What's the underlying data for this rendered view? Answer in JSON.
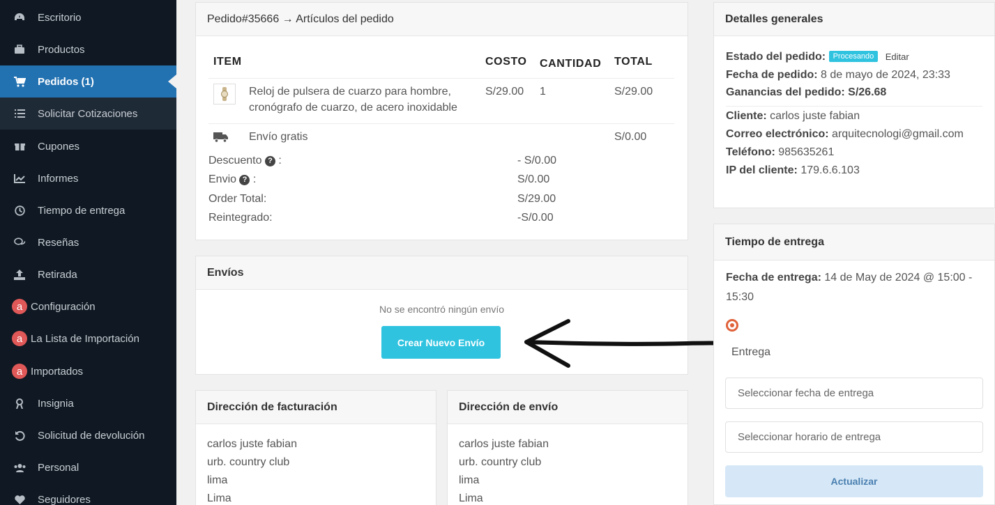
{
  "sidebar": {
    "items": [
      {
        "label": "Escritorio",
        "icon": "dashboard-icon"
      },
      {
        "label": "Productos",
        "icon": "briefcase-icon"
      },
      {
        "label": "Pedidos (1)",
        "icon": "cart-icon"
      },
      {
        "label": "Solicitar Cotizaciones",
        "icon": "list-icon"
      },
      {
        "label": "Cupones",
        "icon": "gift-icon"
      },
      {
        "label": "Informes",
        "icon": "chart-icon"
      },
      {
        "label": "Tiempo de entrega",
        "icon": "clock-icon"
      },
      {
        "label": "Reseñas",
        "icon": "comments-icon"
      },
      {
        "label": "Retirada",
        "icon": "upload-icon"
      },
      {
        "label": "Configuración",
        "icon": "ali-icon"
      },
      {
        "label": "La Lista de Importación",
        "icon": "ali-icon"
      },
      {
        "label": "Importados",
        "icon": "ali-icon"
      },
      {
        "label": "Insignia",
        "icon": "badge-icon"
      },
      {
        "label": "Solicitud de devolución",
        "icon": "undo-icon"
      },
      {
        "label": "Personal",
        "icon": "users-icon"
      },
      {
        "label": "Seguidores",
        "icon": "heart-icon"
      }
    ]
  },
  "order": {
    "title": "Pedido#35666 → Artículos del pedido",
    "headers": {
      "item": "ITEM",
      "cost": "COSTO",
      "qty": "CANTIDAD",
      "total": "TOTAL"
    },
    "product": {
      "name_line1": "Reloj de pulsera de cuarzo para hombre,",
      "name_line2": "cronógrafo de cuarzo, de acero inoxidable",
      "cost": "S/29.00",
      "qty": "1",
      "total": "S/29.00"
    },
    "shipping": {
      "label": "Envío gratis",
      "total": "S/0.00"
    },
    "totals": [
      {
        "label": "Descuento",
        "help": true,
        "value": "- S/0.00"
      },
      {
        "label": "Envio",
        "help": true,
        "value": "S/0.00"
      },
      {
        "label": "Order Total:",
        "help": false,
        "value": "S/29.00"
      },
      {
        "label": "Reintegrado:",
        "help": false,
        "value": "-S/0.00"
      }
    ]
  },
  "shipments": {
    "title": "Envíos",
    "empty": "No se encontró ningún envío",
    "button": "Crear Nuevo Envío"
  },
  "billing": {
    "title": "Dirección de facturación",
    "lines": [
      "carlos juste fabian",
      "urb. country club",
      "lima",
      "Lima"
    ]
  },
  "shipping_address": {
    "title": "Dirección de envío",
    "lines": [
      "carlos juste fabian",
      "urb. country club",
      "lima",
      "Lima"
    ]
  },
  "general": {
    "title": "Detalles generales",
    "status_label": "Estado del pedido:",
    "status": "Procesando",
    "edit": "Editar",
    "date_label": "Fecha de pedido:",
    "date": "8 de mayo de 2024, 23:33",
    "earnings_label": "Ganancias del pedido:",
    "earnings": "S/26.68",
    "client_label": "Cliente:",
    "client": "carlos juste fabian",
    "email_label": "Correo electrónico:",
    "email": "arquitecnologi@gmail.com",
    "phone_label": "Teléfono:",
    "phone": "985635261",
    "ip_label": "IP del cliente:",
    "ip": "179.6.6.103"
  },
  "delivery": {
    "title": "Tiempo de entrega",
    "date_label": "Fecha de entrega:",
    "date_line1": "14 de May de 2024 @ 15:00 -",
    "date_line2": "15:30",
    "radio_label": "Entrega",
    "date_placeholder": "Seleccionar fecha de entrega",
    "time_placeholder": "Seleccionar horario de entrega",
    "update": "Actualizar"
  },
  "colors": {
    "sidebar_bg": "#101923",
    "active": "#2271b1",
    "cyan": "#2fc3e0",
    "ali_red": "#e05858"
  }
}
